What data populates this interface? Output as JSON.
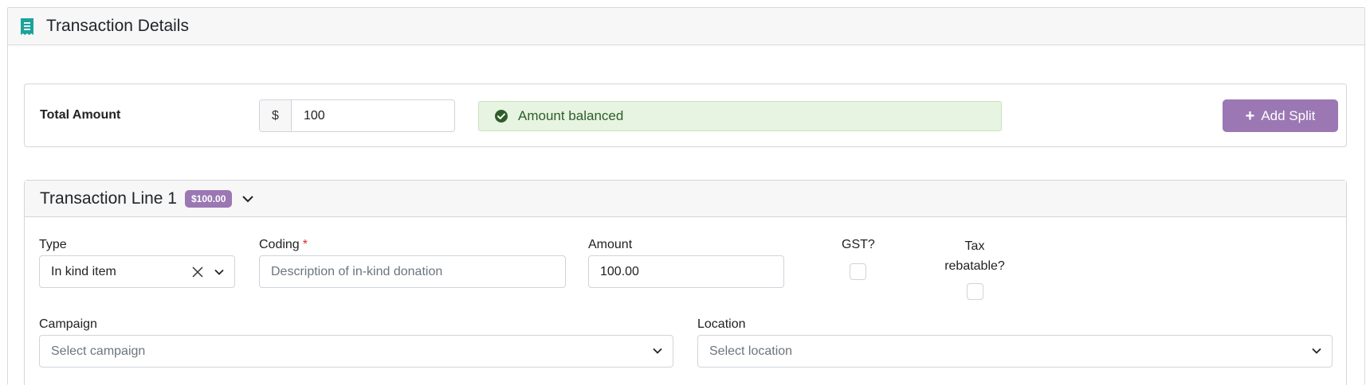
{
  "panel": {
    "title": "Transaction Details",
    "icon": "receipt-icon",
    "accent": "#1aa39a"
  },
  "total": {
    "label": "Total Amount",
    "currency_symbol": "$",
    "value": "100",
    "status": "Amount balanced",
    "status_icon": "check-circle-icon",
    "add_split_label": "Add Split"
  },
  "line": {
    "title": "Transaction Line 1",
    "badge": "$100.00",
    "type": {
      "label": "Type",
      "value": "In kind item"
    },
    "coding": {
      "label": "Coding",
      "required_marker": "*",
      "placeholder": "Description of in-kind donation"
    },
    "amount": {
      "label": "Amount",
      "value": "100.00"
    },
    "gst": {
      "label": "GST?",
      "checked": false
    },
    "tax": {
      "label_line1": "Tax",
      "label_line2": "rebatable?",
      "checked": false
    },
    "campaign": {
      "label": "Campaign",
      "placeholder": "Select campaign"
    },
    "location": {
      "label": "Location",
      "placeholder": "Select location"
    }
  },
  "colors": {
    "brand_purple": "#9b77b3",
    "success_bg": "#e6f4e1",
    "success_text": "#2f5d2a",
    "required": "#d32f2f"
  }
}
